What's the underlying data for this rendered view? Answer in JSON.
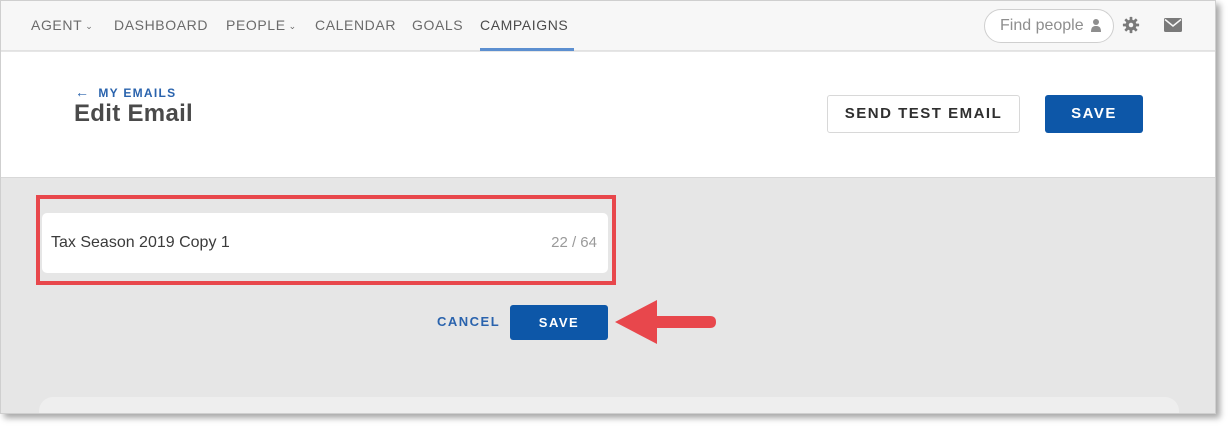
{
  "nav": {
    "items": [
      {
        "label": "AGENT",
        "dropdown": true,
        "active": false
      },
      {
        "label": "DASHBOARD",
        "dropdown": false,
        "active": false
      },
      {
        "label": "PEOPLE",
        "dropdown": true,
        "active": false
      },
      {
        "label": "CALENDAR",
        "dropdown": false,
        "active": false
      },
      {
        "label": "GOALS",
        "dropdown": false,
        "active": false
      },
      {
        "label": "CAMPAIGNS",
        "dropdown": false,
        "active": true
      }
    ],
    "search_placeholder": "Find people",
    "icons": [
      "person-icon",
      "gear-icon",
      "mail-icon"
    ]
  },
  "header": {
    "back_label": "MY EMAILS",
    "title": "Edit Email",
    "send_test_label": "SEND TEST EMAIL",
    "save_label": "SAVE"
  },
  "editor": {
    "name_value": "Tax Season 2019 Copy 1",
    "char_count": "22 / 64",
    "cancel_label": "CANCEL",
    "save_label": "SAVE"
  },
  "colors": {
    "primary": "#0d57a8",
    "link": "#2a63ad",
    "highlight": "#e8474c",
    "background": "#e6e6e6"
  }
}
